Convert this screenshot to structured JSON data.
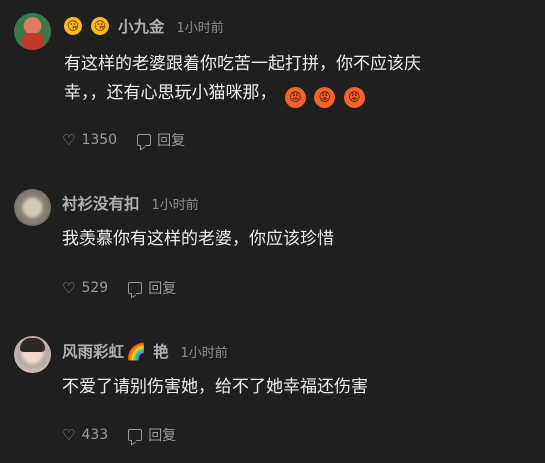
{
  "comments": [
    {
      "username": "小九金",
      "time": "1小时前",
      "text_line1": "有这样的老婆跟着你吃苦一起打拼，你不应该庆",
      "text_line2": "幸，，还有心思玩小猫咪那，",
      "likes": "1350",
      "reply_label": "回复",
      "name_emojis": [
        "😘",
        "😘"
      ],
      "text_emojis": [
        "😡",
        "😡",
        "😡"
      ]
    },
    {
      "username": "衬衫没有扣",
      "time": "1小时前",
      "text_line1": "我羡慕你有这样的老婆，你应该珍惜",
      "likes": "529",
      "reply_label": "回复"
    },
    {
      "username": "风雨彩虹",
      "name_suffix_emoji": "🌈",
      "name_suffix": "艳",
      "time": "1小时前",
      "text_line1": "不爱了请别伤害她，给不了她幸福还伤害",
      "likes": "433",
      "reply_label": "回复"
    }
  ]
}
